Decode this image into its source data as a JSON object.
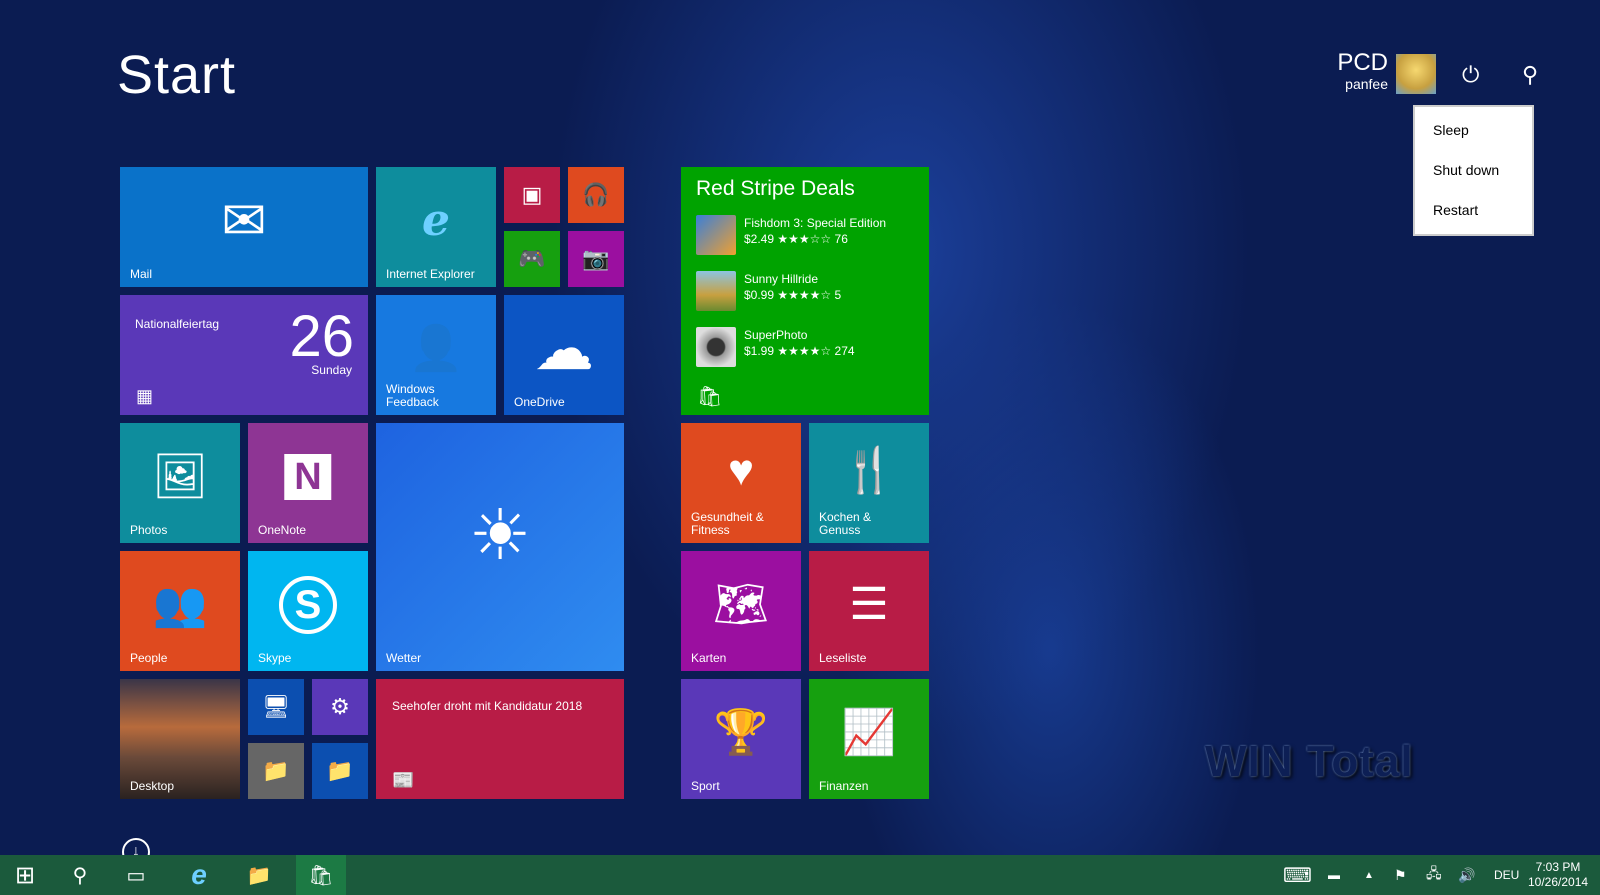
{
  "header": {
    "title": "Start",
    "user_name": "PCD",
    "user_sub": "panfee"
  },
  "power_menu": [
    "Sleep",
    "Shut down",
    "Restart"
  ],
  "tiles": {
    "mail": "Mail",
    "ie": "Internet Explorer",
    "calendar_event": "Nationalfeiertag",
    "calendar_day": "26",
    "calendar_weekday": "Sunday",
    "feedback": "Windows Feedback",
    "onedrive": "OneDrive",
    "photos": "Photos",
    "onenote": "OneNote",
    "wetter": "Wetter",
    "people": "People",
    "skype": "Skype",
    "desktop": "Desktop",
    "news": "Seehofer droht mit Kandidatur 2018",
    "health": "Gesundheit & Fitness",
    "food": "Kochen & Genuss",
    "maps": "Karten",
    "reading": "Leseliste",
    "sport": "Sport",
    "finance": "Finanzen"
  },
  "store": {
    "title": "Red Stripe Deals",
    "deals": [
      {
        "name": "Fishdom 3: Special Edition",
        "price": "$2.49",
        "stars": "★★★☆☆",
        "count": "76"
      },
      {
        "name": "Sunny Hillride",
        "price": "$0.99",
        "stars": "★★★★☆",
        "count": "5"
      },
      {
        "name": "SuperPhoto",
        "price": "$1.99",
        "stars": "★★★★☆",
        "count": "274"
      }
    ]
  },
  "watermark": "WIN Total",
  "tray": {
    "lang": "DEU",
    "time": "7:03 PM",
    "date": "10/26/2014"
  },
  "colors": {
    "taskbar": "#1b5a3c",
    "store": "#00a300"
  }
}
